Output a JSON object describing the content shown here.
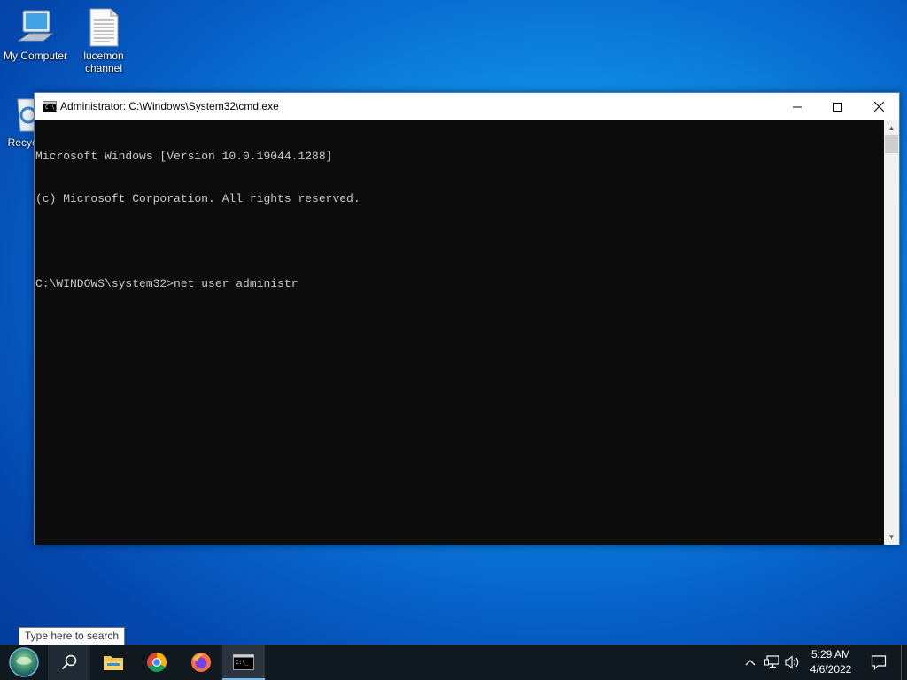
{
  "desktop": {
    "icons": [
      {
        "label": "My Computer"
      },
      {
        "label": "lucemon\nchannel"
      },
      {
        "label": "Recyc"
      }
    ]
  },
  "window": {
    "title": "Administrator: C:\\Windows\\System32\\cmd.exe",
    "icon": "cmd-icon",
    "controls": {
      "minimize": "minimize-icon",
      "maximize": "maximize-icon",
      "close": "close-icon"
    },
    "console_lines": [
      "Microsoft Windows [Version 10.0.19044.1288]",
      "(c) Microsoft Corporation. All rights reserved.",
      "",
      "C:\\WINDOWS\\system32>net user administr"
    ]
  },
  "search_tooltip": "Type here to search",
  "taskbar": {
    "items": [
      {
        "name": "start",
        "icon": "start-orb-icon"
      },
      {
        "name": "search",
        "icon": "search-icon"
      },
      {
        "name": "file-explorer",
        "icon": "folder-icon"
      },
      {
        "name": "chrome",
        "icon": "chrome-icon"
      },
      {
        "name": "firefox",
        "icon": "firefox-icon"
      },
      {
        "name": "command-prompt",
        "icon": "cmd-icon",
        "active": true
      }
    ],
    "tray": {
      "icons": [
        "chevron-up-icon",
        "network-icon",
        "volume-icon",
        "notification-icon"
      ],
      "time": "5:29 AM",
      "date": "4/6/2022"
    }
  },
  "colors": {
    "console_bg": "#0c0c0c",
    "console_text": "#cccccc",
    "taskbar_bg": "#101820",
    "active_indicator": "#76b9ed"
  }
}
